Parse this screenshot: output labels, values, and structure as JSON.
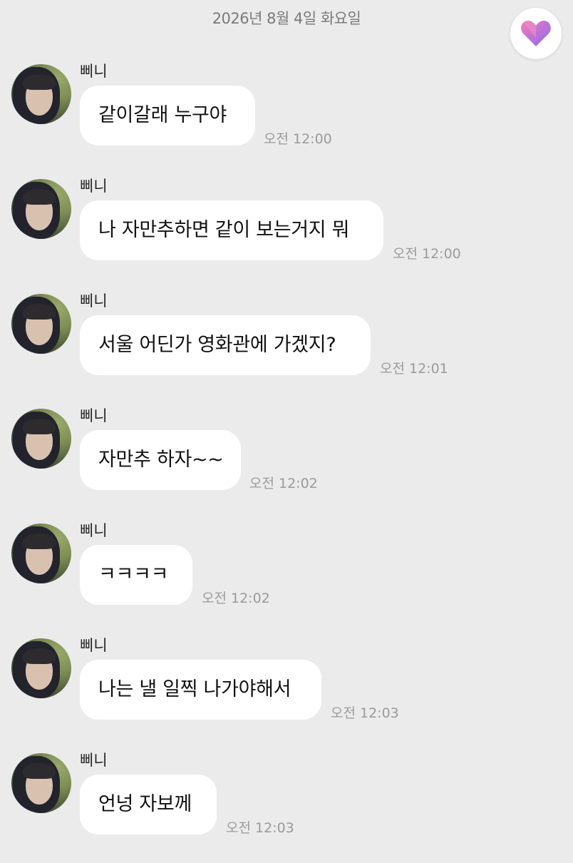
{
  "date_header": "2026년 8월 4일 화요일",
  "heart_button": {
    "icon": "heart-icon",
    "colors": [
      "#f47bb8",
      "#8a6cf0"
    ]
  },
  "messages": [
    {
      "sender": "삐니",
      "text": "같이갈래 누구야",
      "time": "오전 12:00"
    },
    {
      "sender": "삐니",
      "text": "나 자만추하면 같이 보는거지 뭐",
      "time": "오전 12:00"
    },
    {
      "sender": "삐니",
      "text": "서울 어딘가 영화관에 가겠지?",
      "time": "오전 12:01"
    },
    {
      "sender": "삐니",
      "text": "자만추 하자~~",
      "time": "오전 12:02"
    },
    {
      "sender": "삐니",
      "text": "ㅋㅋㅋㅋ",
      "time": "오전 12:02"
    },
    {
      "sender": "삐니",
      "text": "나는 낼 일찍 나가야해서",
      "time": "오전 12:03"
    },
    {
      "sender": "삐니",
      "text": "언넝 자보께",
      "time": "오전 12:03"
    }
  ]
}
